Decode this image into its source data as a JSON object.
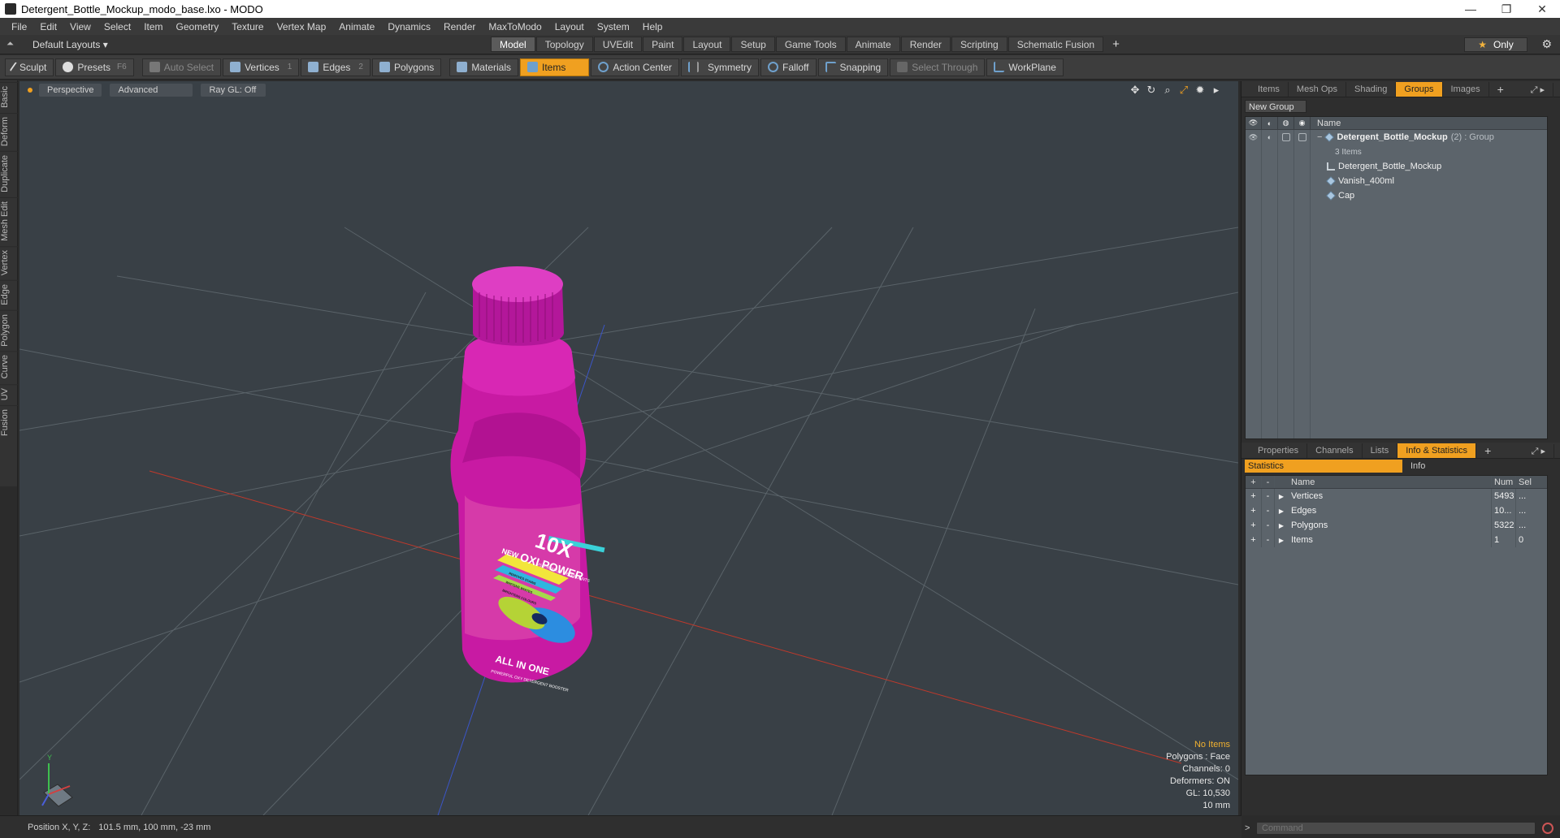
{
  "window": {
    "title": "Detergent_Bottle_Mockup_modo_base.lxo - MODO",
    "min": "—",
    "max": "❐",
    "close": "✕"
  },
  "menu": [
    "File",
    "Edit",
    "View",
    "Select",
    "Item",
    "Geometry",
    "Texture",
    "Vertex Map",
    "Animate",
    "Dynamics",
    "Render",
    "MaxToModo",
    "Layout",
    "System",
    "Help"
  ],
  "layout": {
    "preset": "Default Layouts ▾",
    "tabs": [
      "Model",
      "Topology",
      "UVEdit",
      "Paint",
      "Layout",
      "Setup",
      "Game Tools",
      "Animate",
      "Render",
      "Scripting",
      "Schematic Fusion"
    ],
    "active_tab": "Model",
    "only_label": "Only"
  },
  "toolbar": {
    "sculpt": "Sculpt",
    "presets": "Presets",
    "presets_key": "F6",
    "auto_select": "Auto Select",
    "vertices": "Vertices",
    "vertices_count": "1",
    "edges": "Edges",
    "edges_count": "2",
    "polygons": "Polygons",
    "materials": "Materials",
    "items": "Items",
    "action_center": "Action Center",
    "symmetry": "Symmetry",
    "falloff": "Falloff",
    "snapping": "Snapping",
    "select_through": "Select Through",
    "workplane": "WorkPlane"
  },
  "left_tabs": [
    "Basic",
    "Deform",
    "Duplicate",
    "Mesh Edit",
    "Vertex",
    "Edge",
    "Polygon",
    "Curve",
    "UV",
    "Fusion"
  ],
  "viewport": {
    "view": "Perspective",
    "shading": "Advanced",
    "raygl": "Ray GL: Off",
    "label_big": "10X",
    "label_oxi": "OXI POWER",
    "label_new": "NEW",
    "label_detergent": "VS. PREMIUM DETERGENTS",
    "label_allinone": "ALL IN ONE",
    "label_sub": "POWERFUL OXY DETERGENT BOOSTER",
    "strip1": "REMOVES STAINS",
    "strip2": "WHITENS WHITES",
    "strip3": "BRIGHTENS COLOURS",
    "info": {
      "no_items": "No Items",
      "polygons": "Polygons : Face",
      "channels": "Channels: 0",
      "deformers": "Deformers: ON",
      "gl": "GL: 10,530",
      "scale": "10 mm"
    },
    "axis_y": "Y"
  },
  "status": {
    "label": "Position X, Y, Z:",
    "value": "101.5 mm, 100 mm, -23 mm"
  },
  "groups_panel": {
    "tabs": [
      "Items",
      "Mesh Ops",
      "Shading",
      "Groups",
      "Images"
    ],
    "active_tab": "Groups",
    "new_group": "New Group",
    "col_name": "Name",
    "group_name": "Detergent_Bottle_Mockup",
    "group_count": "(2)",
    "group_type": ": Group",
    "group_sub": "3 Items",
    "children": [
      "Detergent_Bottle_Mockup",
      "Vanish_400ml",
      "Cap"
    ]
  },
  "info_panel": {
    "tabs": [
      "Properties",
      "Channels",
      "Lists",
      "Info & Statistics"
    ],
    "active_tab": "Info & Statistics",
    "sub_tabs": [
      "Statistics",
      "Info"
    ],
    "columns": {
      "name": "Name",
      "num": "Num",
      "sel": "Sel"
    },
    "rows": [
      {
        "name": "Vertices",
        "num": "5493",
        "sel": "..."
      },
      {
        "name": "Edges",
        "num": "10...",
        "sel": "..."
      },
      {
        "name": "Polygons",
        "num": "5322",
        "sel": "..."
      },
      {
        "name": "Items",
        "num": "1",
        "sel": "0"
      }
    ],
    "command_placeholder": "Command"
  },
  "colors": {
    "accent": "#f0a020",
    "bottle": "#d21fae",
    "viewport_bg": "#394046"
  }
}
